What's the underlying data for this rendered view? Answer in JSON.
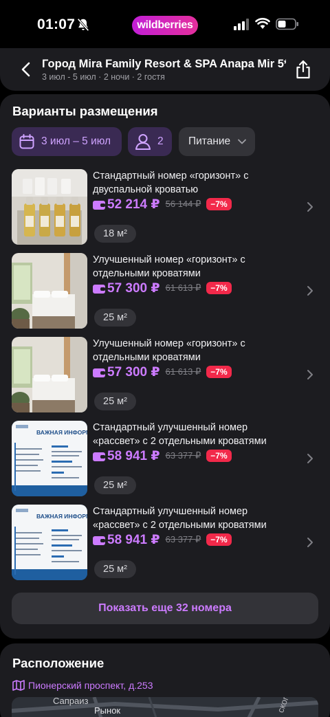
{
  "status_bar": {
    "time": "01:07",
    "brand": "wildberries"
  },
  "header": {
    "title": "Город Mira Family Resort & SPA Anapa Mir 5*",
    "subtitle": "3 июл - 5 июл · 2 ночи · 2 гостя"
  },
  "rooms_section": {
    "title": "Варианты размещения",
    "filters": {
      "dates": "3 июл – 5 июл",
      "guests": "2",
      "food": "Питание"
    },
    "rooms": [
      {
        "name": "Стандартный номер «горизонт» с двуспальной кроватью",
        "price": "52 214 ₽",
        "old_price": "56 144 ₽",
        "discount": "−7%",
        "area": "18 м²"
      },
      {
        "name": "Улучшенный номер «горизонт» с отдельными кроватями",
        "price": "57 300 ₽",
        "old_price": "61 613 ₽",
        "discount": "−7%",
        "area": "25 м²"
      },
      {
        "name": "Улучшенный номер «горизонт» с отдельными кроватями",
        "price": "57 300 ₽",
        "old_price": "61 613 ₽",
        "discount": "−7%",
        "area": "25 м²"
      },
      {
        "name": "Стандартный улучшенный номер «рассвет» с 2 отдельными кроватями",
        "price": "58 941 ₽",
        "old_price": "63 377 ₽",
        "discount": "−7%",
        "area": "25 м²"
      },
      {
        "name": "Стандартный улучшенный номер «рассвет» с 2 отдельными кроватями",
        "price": "58 941 ₽",
        "old_price": "63 377 ₽",
        "discount": "−7%",
        "area": "25 м²"
      }
    ],
    "info_image_heading": "ВАЖНАЯ ИНФОРМ",
    "show_more": "Показать еще 32 номера"
  },
  "location": {
    "title": "Расположение",
    "address": "Пионерский проспект, д.253",
    "map_labels": [
      "Сапраиз",
      "Рынок",
      "ского"
    ]
  },
  "colors": {
    "accent": "#cc7bff",
    "discount": "#f2294a",
    "card": "#1c1c20"
  }
}
